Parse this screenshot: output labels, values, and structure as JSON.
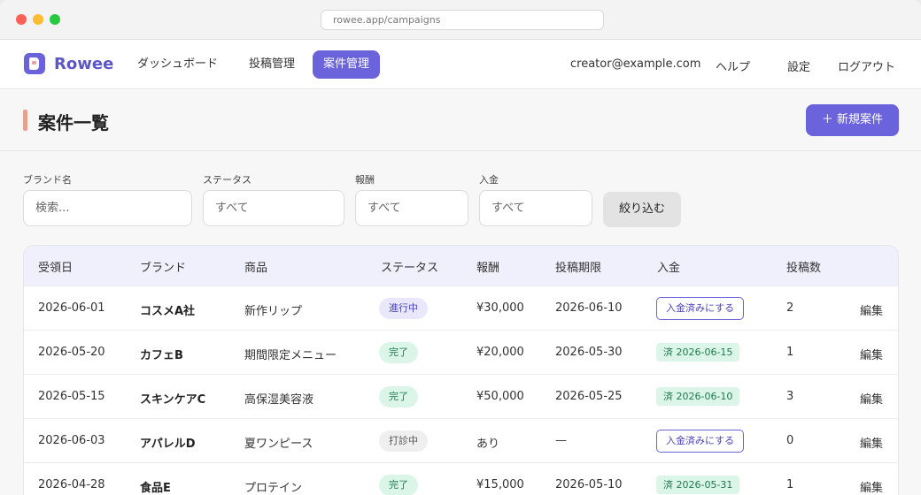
{
  "browser": {
    "url": "rowee.app/campaigns"
  },
  "nav": {
    "brand": "Rowee",
    "links": [
      "ダッシュボード",
      "投稿管理",
      "案件管理"
    ],
    "email": "creator@example.com",
    "help": "ヘルプ",
    "settings": "設定",
    "logout": "ログアウト"
  },
  "header": {
    "title": "案件一覧",
    "new_button": "＋ 新規案件"
  },
  "filters": {
    "brand_label": "ブランド名",
    "brand_placeholder": "検索...",
    "status_label": "ステータス",
    "status_value": "すべて",
    "reward_label": "報酬",
    "reward_value": "すべて",
    "payment_label": "入金",
    "payment_value": "すべて",
    "apply_button": "絞り込む"
  },
  "table": {
    "headers": [
      "受領日",
      "ブランド",
      "商品",
      "ステータス",
      "報酬",
      "投稿期限",
      "入金",
      "投稿数"
    ],
    "edit_label": "編集",
    "rows": [
      {
        "date": "2026-06-01",
        "brand": "コスメA社",
        "product": "新作リップ",
        "status": "進行中",
        "reward": "¥30,000",
        "deadline": "2026-06-10",
        "payment": "入金済みにする",
        "posts": "2"
      },
      {
        "date": "2026-05-20",
        "brand": "カフェB",
        "product": "期間限定メニュー",
        "status": "完了",
        "reward": "¥20,000",
        "deadline": "2026-05-30",
        "payment": "済 2026-06-15",
        "posts": "1"
      },
      {
        "date": "2026-05-15",
        "brand": "スキンケアC",
        "product": "高保湿美容液",
        "status": "完了",
        "reward": "¥50,000",
        "deadline": "2026-05-25",
        "payment": "済 2026-06-10",
        "posts": "3"
      },
      {
        "date": "2026-06-03",
        "brand": "アパレルD",
        "product": "夏ワンピース",
        "status": "打診中",
        "reward": "あり",
        "deadline": "—",
        "payment": "入金済みにする",
        "posts": "0"
      },
      {
        "date": "2026-04-28",
        "brand": "食品E",
        "product": "プロテイン",
        "status": "完了",
        "reward": "¥15,000",
        "deadline": "2026-05-10",
        "payment": "済 2026-05-31",
        "posts": "1"
      }
    ]
  }
}
